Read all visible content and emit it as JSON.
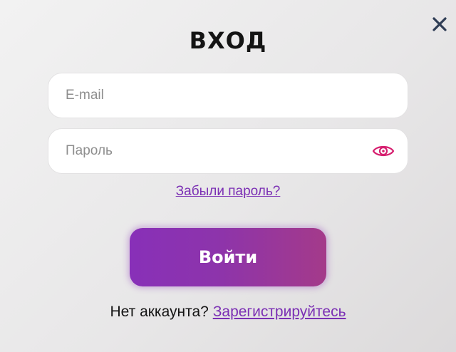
{
  "dialog": {
    "title": "ВХОД",
    "close_icon": "close-icon"
  },
  "email": {
    "placeholder": "E-mail",
    "value": ""
  },
  "password": {
    "placeholder": "Пароль",
    "value": "",
    "toggle_icon": "eye-icon"
  },
  "links": {
    "forgot_password": "Забыли пароль?"
  },
  "login_button": {
    "label": "Войти"
  },
  "signup": {
    "prompt": "Нет аккаунта?",
    "link": "Зарегистрируйтесь"
  },
  "colors": {
    "accent": "#7b2fb4",
    "eye_icon": "#d6206f",
    "button_start": "#8830b8",
    "button_end": "#a43a8a",
    "close_icon": "#2f3d55"
  }
}
